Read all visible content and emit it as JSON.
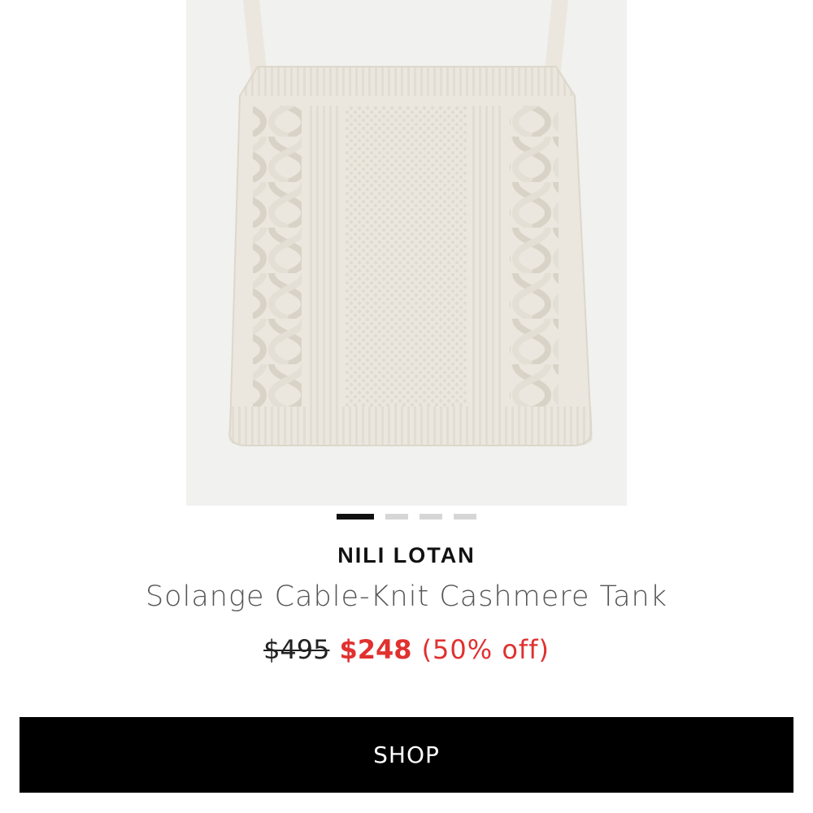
{
  "product": {
    "image_alt": "Solange Cable-Knit Cashmere Tank",
    "brand": "NILI LOTAN",
    "name": "Solange Cable-Knit Cashmere Tank",
    "price_original": "$495",
    "price_sale": "$248",
    "discount": "(50% off)"
  },
  "carousel": {
    "total": 4,
    "active_index": 0
  },
  "actions": {
    "shop_label": "SHOP"
  },
  "colors": {
    "sale": "#e0312f",
    "button_bg": "#000000",
    "image_bg": "#f1f1ef",
    "garment": "#ebe7de"
  }
}
